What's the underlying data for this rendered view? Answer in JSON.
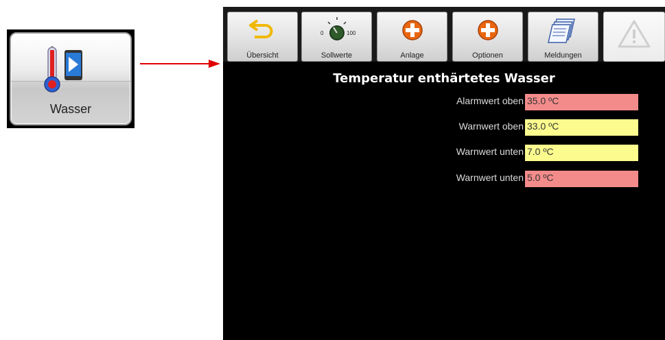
{
  "icon_card": {
    "label": "Wasser"
  },
  "toolbar": {
    "buttons": [
      {
        "label": "Übersicht",
        "icon": "back-arrow-icon"
      },
      {
        "label": "Sollwerte",
        "icon": "dial-icon",
        "dial_min": "0",
        "dial_max": "100"
      },
      {
        "label": "Anlage",
        "icon": "plus-circle-icon"
      },
      {
        "label": "Optionen",
        "icon": "plus-circle-icon"
      },
      {
        "label": "Meldungen",
        "icon": "pages-icon"
      }
    ],
    "warning_button": {
      "icon": "warning-triangle-icon"
    }
  },
  "screen": {
    "title": "Temperatur enthärtetes Wasser",
    "rows": [
      {
        "label": "Alarmwert oben",
        "value": "35.0 ºC",
        "color": "#f48b8b"
      },
      {
        "label": "Warnwert oben",
        "value": "33.0 ºC",
        "color": "#fbfb8e"
      },
      {
        "label": "Warnwert unten",
        "value": "7.0 ºC",
        "color": "#fbfb8e"
      },
      {
        "label": "Warnwert unten",
        "value": "5.0 ºC",
        "color": "#f48b8b"
      }
    ]
  },
  "colors": {
    "arrow": "#e00000",
    "background": "#000000",
    "title": "#ffffff"
  }
}
